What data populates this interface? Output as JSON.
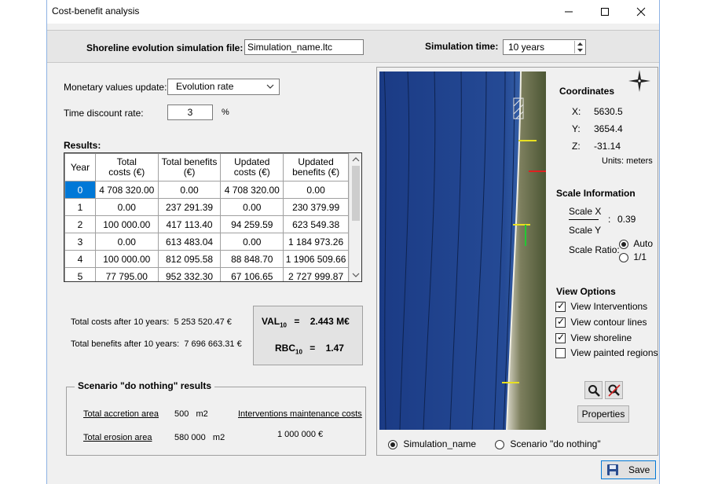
{
  "window": {
    "title": "Cost-benefit analysis"
  },
  "header": {
    "sim_file_label": "Shoreline evolution simulation file:",
    "sim_file_value": "Simulation_name.ltc",
    "sim_time_label": "Simulation time:",
    "sim_time_value": "10 years"
  },
  "settings": {
    "monetary_label": "Monetary values update:",
    "monetary_value": "Evolution rate",
    "discount_label": "Time discount rate:",
    "discount_value": "3",
    "discount_unit": "%"
  },
  "results": {
    "title": "Results:",
    "headers": [
      "Year",
      "Total\ncosts (€)",
      "Total benefits\n(€)",
      "Updated\ncosts (€)",
      "Updated\nbenefits (€)"
    ],
    "rows": [
      [
        "0",
        "4 708 320.00",
        "0.00",
        "4 708 320.00",
        "0.00"
      ],
      [
        "1",
        "0.00",
        "237 291.39",
        "0.00",
        "230 379.99"
      ],
      [
        "2",
        "100 000.00",
        "417 113.40",
        "94 259.59",
        "623 549.38"
      ],
      [
        "3",
        "0.00",
        "613 483.04",
        "0.00",
        "1 184 973.26"
      ],
      [
        "4",
        "100 000.00",
        "812 095.58",
        "88 848.70",
        "1 1906 509.66"
      ],
      [
        "5",
        "77 795.00",
        "952 332.30",
        "67 106.65",
        "2 727 999.87"
      ]
    ],
    "selected_row": 0
  },
  "totals": {
    "costs_label": "Total costs after 10 years:",
    "costs_value": "5 253 520.47 €",
    "benefits_label": "Total benefits after 10 years:",
    "benefits_value": "7 696 663.31 €"
  },
  "indicators": {
    "val_label": "VAL",
    "val_sub": "10",
    "val_value": "2.443 M€",
    "rbc_label": "RBC",
    "rbc_sub": "10",
    "rbc_value": "1.47",
    "eq": "="
  },
  "scenario": {
    "title": "Scenario \"do nothing\" results",
    "accretion_label": "Total accretion area",
    "accretion_value": "500   m2",
    "erosion_label": "Total erosion area",
    "erosion_value": "580 000   m2",
    "maintenance_label": "Interventions maintenance costs",
    "maintenance_value": "1 000 000 €"
  },
  "coordinates": {
    "title": "Coordinates",
    "x_label": "X:",
    "x_value": "5630.5",
    "y_label": "Y:",
    "y_value": "3654.4",
    "z_label": "Z:",
    "z_value": "-31.14",
    "units": "Units: meters"
  },
  "scale": {
    "title": "Scale Information",
    "x_label": "Scale X",
    "y_label": "Scale Y",
    "sep": ":",
    "value": "0.39",
    "ratio_label": "Scale Ratio:",
    "auto_label": "Auto",
    "one_label": "1/1",
    "selected": "Auto"
  },
  "view_options": {
    "title": "View Options",
    "items": [
      {
        "label": "View Interventions",
        "checked": true
      },
      {
        "label": "View contour lines",
        "checked": true
      },
      {
        "label": "View shoreline",
        "checked": true
      },
      {
        "label": "View painted regions",
        "checked": false
      }
    ]
  },
  "tools": {
    "properties_label": "Properties"
  },
  "map_toggle": {
    "option1": "Simulation_name",
    "option2": "Scenario \"do nothing\"",
    "selected": "Simulation_name"
  },
  "footer": {
    "save_label": "Save"
  },
  "colors": {
    "selection": "#0078d7",
    "ocean": "#1b3f8a",
    "marker_yellow": "#e8e021",
    "marker_green": "#22c933",
    "marker_red": "#e02020"
  }
}
